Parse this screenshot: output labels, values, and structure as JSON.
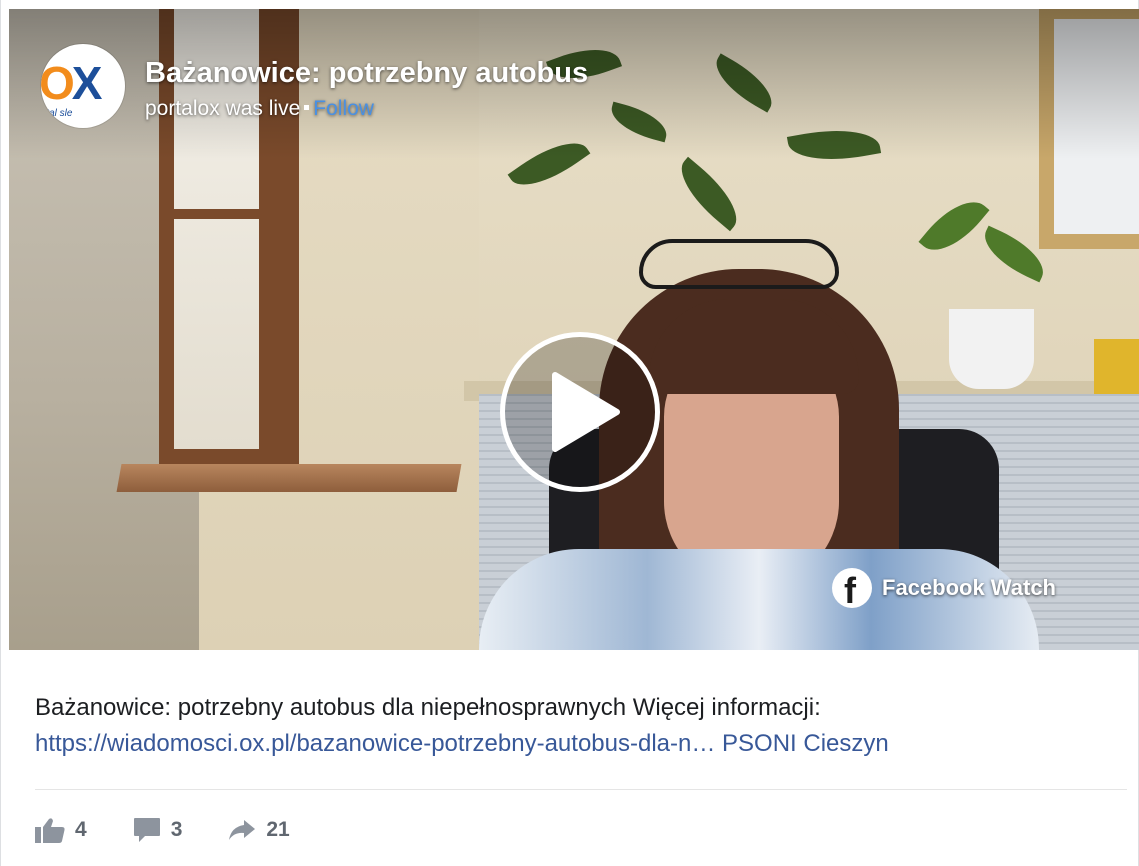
{
  "post": {
    "title": "Bażanowice: potrzebny autobus",
    "author": "portalox",
    "status": "was live",
    "follow_label": "Follow",
    "watch_label": "Facebook Watch",
    "description": "Bażanowice: potrzebny autobus dla niepełnosprawnych Więcej informacji:",
    "link_text": "https://wiadomosci.ox.pl/bazanowice-potrzebny-autobus-dla-n…",
    "tag": "PSONI Cieszyn"
  },
  "avatar": {
    "logo_o": "O",
    "logo_x": "X",
    "logo_sub": "rtal sle"
  },
  "stats": {
    "likes": "4",
    "comments": "3",
    "shares": "21"
  },
  "colors": {
    "link": "#385898",
    "follow": "#4a90e2",
    "stat_text": "#606770",
    "divider": "#e5e5e5"
  },
  "icons": [
    "facebook-logo-icon",
    "play-icon",
    "like-icon",
    "comment-icon",
    "share-icon"
  ]
}
